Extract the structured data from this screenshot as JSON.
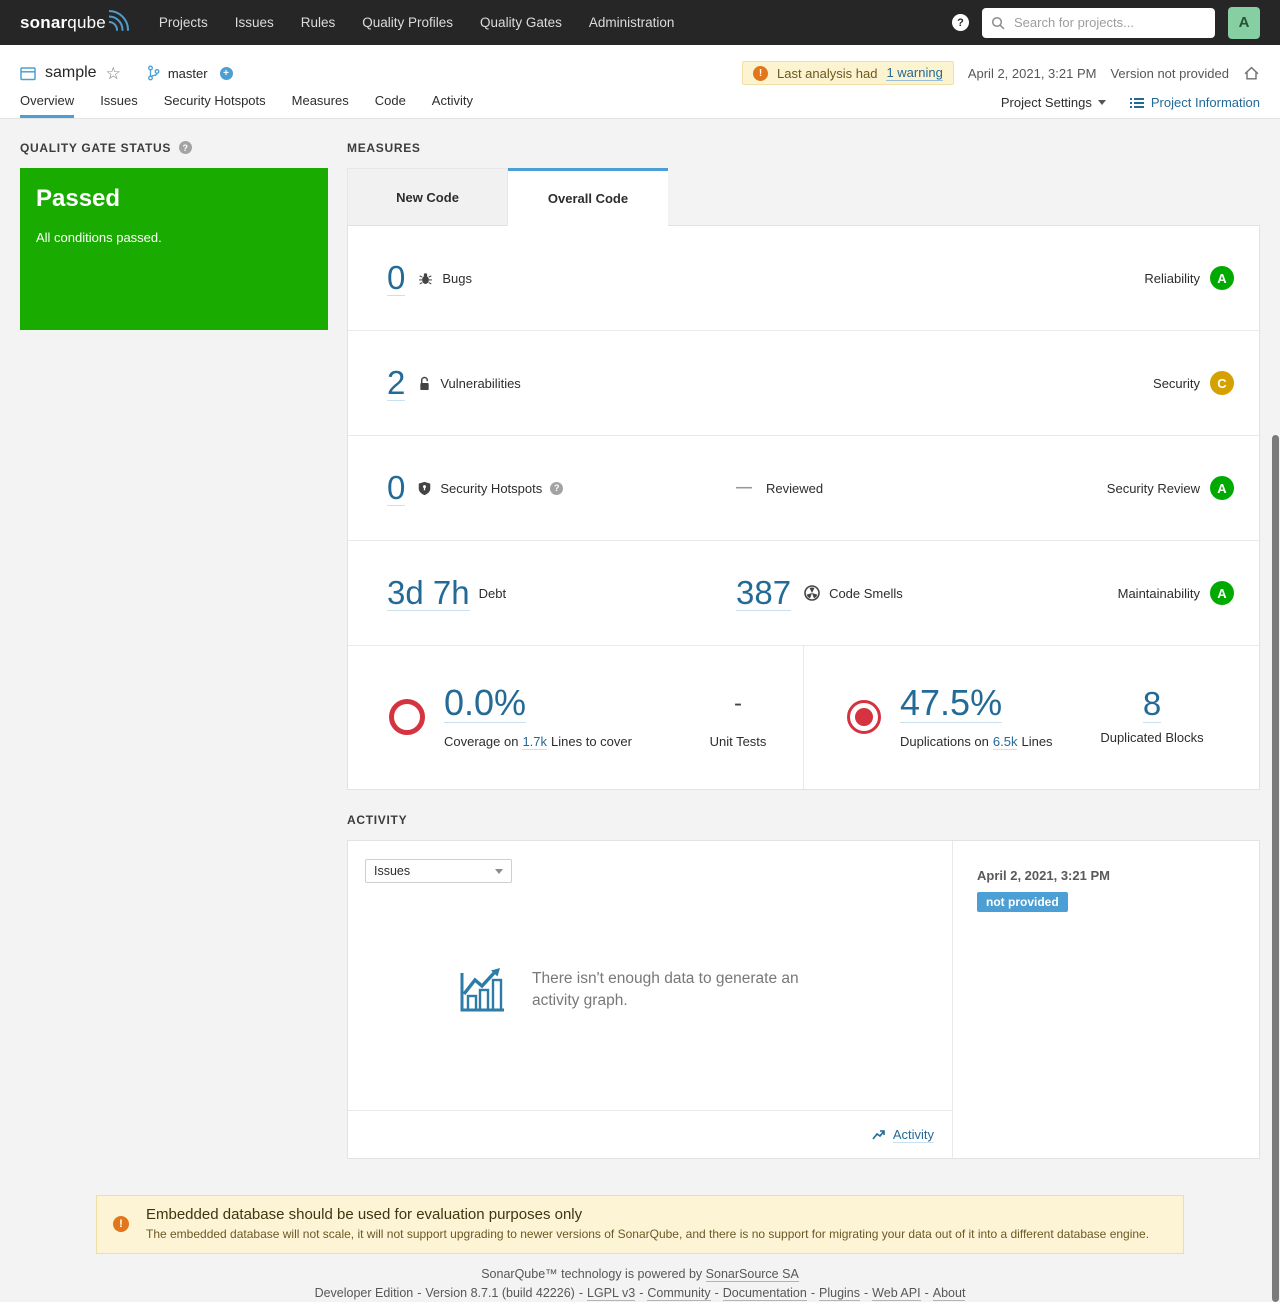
{
  "colors": {
    "navbar_dark": "#262626",
    "accent_blue": "#4b9fd5",
    "link_blue": "#236a97",
    "passed_green": "#1aab00",
    "rating_a_green": "#00aa00",
    "rating_c_yellow": "#d4a100",
    "alert_red": "#d4333f",
    "warning_orange": "#e2761b",
    "badge_blue": "#4b9fd5"
  },
  "nav": {
    "logo_sonar": "sonar",
    "logo_qube": "qube",
    "items": [
      "Projects",
      "Issues",
      "Rules",
      "Quality Profiles",
      "Quality Gates",
      "Administration"
    ],
    "help_glyph": "?",
    "search_placeholder": "Search for projects...",
    "avatar_letter": "A"
  },
  "header": {
    "project_name": "sample",
    "branch_name": "master",
    "warning_prefix": "Last analysis had",
    "warning_link": "1 warning",
    "warning_glyph": "!",
    "analysis_date": "April 2, 2021, 3:21 PM",
    "version_label": "Version not provided",
    "tabs": [
      "Overview",
      "Issues",
      "Security Hotspots",
      "Measures",
      "Code",
      "Activity"
    ],
    "active_tab": "Overview",
    "project_settings_label": "Project Settings",
    "project_information_label": "Project Information"
  },
  "quality_gate": {
    "section_title": "QUALITY GATE STATUS",
    "help_glyph": "?",
    "status": "Passed",
    "subtitle": "All conditions passed."
  },
  "measures": {
    "section_title": "MEASURES",
    "tabs": [
      "New Code",
      "Overall Code"
    ],
    "active_tab": "Overall Code",
    "bugs": {
      "value": "0",
      "label": "Bugs",
      "domain": "Reliability",
      "rating": "A"
    },
    "vulnerabilities": {
      "value": "2",
      "label": "Vulnerabilities",
      "domain": "Security",
      "rating": "C"
    },
    "hotspots": {
      "value": "0",
      "label": "Security Hotspots",
      "help_glyph": "?",
      "reviewed_value": "—",
      "reviewed_label": "Reviewed",
      "domain": "Security Review",
      "rating": "A"
    },
    "maintainability": {
      "debt_value": "3d 7h",
      "debt_label": "Debt",
      "smells_value": "387",
      "smells_label": "Code Smells",
      "domain": "Maintainability",
      "rating": "A"
    },
    "coverage": {
      "value": "0.0%",
      "caption_prefix": "Coverage on",
      "caption_link": "1.7k",
      "caption_suffix": "Lines to cover",
      "tests_value": "-",
      "tests_label": "Unit Tests"
    },
    "duplications": {
      "value": "47.5%",
      "caption_prefix": "Duplications on",
      "caption_link": "6.5k",
      "caption_suffix": "Lines",
      "blocks_value": "8",
      "blocks_label": "Duplicated Blocks"
    }
  },
  "activity": {
    "section_title": "ACTIVITY",
    "graph_select_value": "Issues",
    "empty_message": "There isn't enough data to generate an activity graph.",
    "footer_link": "Activity",
    "sidebar_date": "April 2, 2021, 3:21 PM",
    "sidebar_badge": "not provided"
  },
  "db_warning": {
    "glyph": "!",
    "title": "Embedded database should be used for evaluation purposes only",
    "description": "The embedded database will not scale, it will not support upgrading to newer versions of SonarQube, and there is no support for migrating your data out of it into a different database engine."
  },
  "footer": {
    "powered_prefix": "SonarQube™ technology is powered by",
    "powered_link": "SonarSource SA",
    "edition": "Developer Edition",
    "version": "Version 8.7.1 (build 42226)",
    "separator": "-",
    "links": [
      "LGPL v3",
      "Community",
      "Documentation",
      "Plugins",
      "Web API",
      "About"
    ]
  }
}
